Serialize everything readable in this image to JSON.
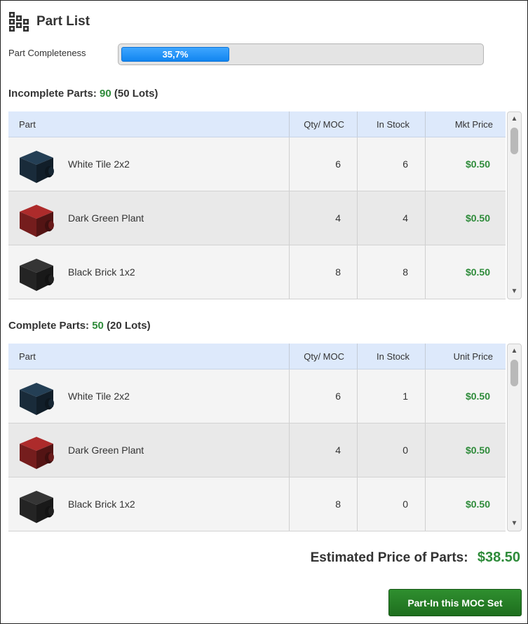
{
  "header": {
    "title": "Part List",
    "icon": "bricks-icon"
  },
  "completeness": {
    "label": "Part Completeness",
    "value_text": "35,7%",
    "fraction": 0.3
  },
  "incomplete": {
    "title": "Incomplete Parts:",
    "count": "90",
    "lots": "(50 Lots)",
    "columns": {
      "part": "Part",
      "qty": "Qty/ MOC",
      "stock": "In Stock",
      "price": "Mkt Price"
    },
    "rows": [
      {
        "name": "White Tile 2x2",
        "qty": "6",
        "stock": "6",
        "price": "$0.50",
        "color": "#1d3244"
      },
      {
        "name": "Dark Green Plant",
        "qty": "4",
        "stock": "4",
        "price": "$0.50",
        "color": "#8a2222"
      },
      {
        "name": "Black Brick 1x2",
        "qty": "8",
        "stock": "8",
        "price": "$0.50",
        "color": "#2a2a2a"
      }
    ]
  },
  "complete": {
    "title": "Complete Parts:",
    "count": "50",
    "lots": "(20 Lots)",
    "columns": {
      "part": "Part",
      "qty": "Qty/ MOC",
      "stock": "In Stock",
      "price": "Unit Price"
    },
    "rows": [
      {
        "name": "White Tile 2x2",
        "qty": "6",
        "stock": "1",
        "price": "$0.50",
        "color": "#1d3244"
      },
      {
        "name": "Dark Green Plant",
        "qty": "4",
        "stock": "0",
        "price": "$0.50",
        "color": "#8a2222"
      },
      {
        "name": "Black Brick 1x2",
        "qty": "8",
        "stock": "0",
        "price": "$0.50",
        "color": "#2a2a2a"
      }
    ]
  },
  "footer": {
    "estimate_label": "Estimated Price of Parts:",
    "estimate_value": "$38.50",
    "button_label": "Part-In this MOC Set"
  },
  "colors": {
    "accent_green": "#2e8b3a",
    "progress_blue": "#1185f0",
    "header_blue": "#dde9fb"
  }
}
